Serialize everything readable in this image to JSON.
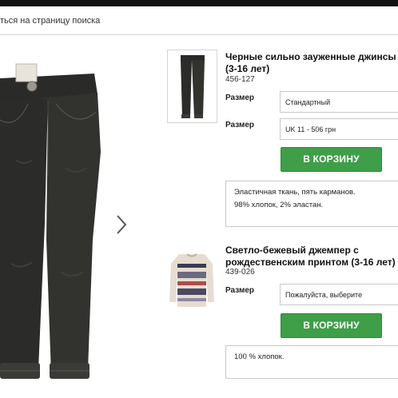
{
  "header": {
    "back_link": "ться на страницу поиска"
  },
  "main_image": {
    "icon": "jeans-photo",
    "next_icon": "chevron-right-icon"
  },
  "products": [
    {
      "thumbnail_icon": "black-jeans-thumbnail",
      "title": "Черные сильно зауженные джинсы (3-16 лет)",
      "code": "456-127",
      "size_label_1": "Размер",
      "size_value_1": "Стандартный",
      "size_label_2": "Размер",
      "size_value_2": "UK 11 - 506 грн",
      "cart_label": "В КОРЗИНУ",
      "description_line_1": "Эластичная ткань, пять карманов.",
      "description_line_2": "98% хлопок, 2% эластан."
    },
    {
      "thumbnail_icon": "christmas-sweater-thumbnail",
      "title": "Светло-бежевый джемпер с рождественским принтом (3-16 лет)",
      "code": "439-026",
      "size_label": "Размер",
      "size_value": "Пожалуйста, выберите",
      "cart_label": "В КОРЗИНУ",
      "description_line_1": "100 % хлопок."
    }
  ],
  "colors": {
    "cart_button": "#3f9e48",
    "top_bar": "#111111"
  }
}
